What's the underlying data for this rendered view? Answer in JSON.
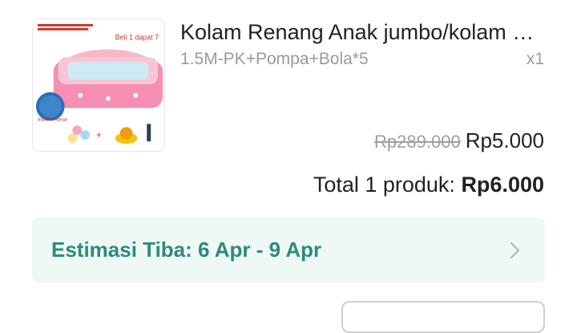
{
  "product": {
    "title": "Kolam Renang Anak jumbo/kolam …",
    "variant": "1.5M-PK+Pompa+Bola*5",
    "quantity": "x1",
    "original_price": "Rp289.000",
    "price": "Rp5.000",
    "thumbnail_icon": "inflatable-pool-product-image"
  },
  "summary": {
    "total_label": "Total 1 produk:",
    "total_amount": "Rp6.000"
  },
  "shipping": {
    "estimate_label": "Estimasi Tiba: 6 Apr - 9 Apr",
    "chevron_icon": "chevron-right-icon"
  },
  "colors": {
    "accent_teal": "#2d8a7a",
    "estimate_bg": "#eef8f5"
  }
}
